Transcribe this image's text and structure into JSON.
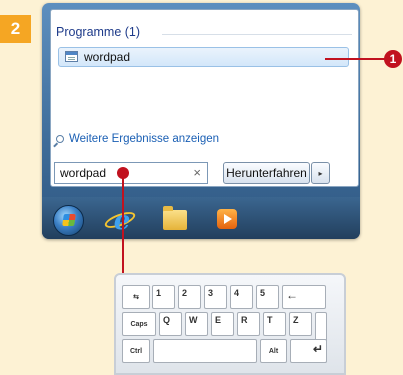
{
  "step_number": "2",
  "callout_number": "1",
  "start_menu": {
    "section_header": "Programme (1)",
    "result_item": "wordpad",
    "more_results": "Weitere Ergebnisse anzeigen",
    "search_value": "wordpad",
    "clear_symbol": "×",
    "shutdown_label": "Herunterfahren",
    "shutdown_arrow": "▸"
  },
  "taskbar": {
    "icons": [
      "windows-start-orb",
      "internet-explorer-icon",
      "explorer-folder-icon",
      "media-player-icon"
    ]
  },
  "keyboard": {
    "tab_key": "⇆",
    "row1": [
      "1",
      "2",
      "3",
      "4",
      "5"
    ],
    "backspace": "←",
    "caps": "Caps",
    "row2": [
      "Q",
      "W",
      "E",
      "R",
      "T",
      "Z"
    ],
    "ctrl": "Ctrl",
    "alt": "Alt",
    "enter": "↵"
  },
  "colors": {
    "callout_red": "#c1121f",
    "badge_orange": "#f5a623",
    "background": "#fdf2d4"
  }
}
